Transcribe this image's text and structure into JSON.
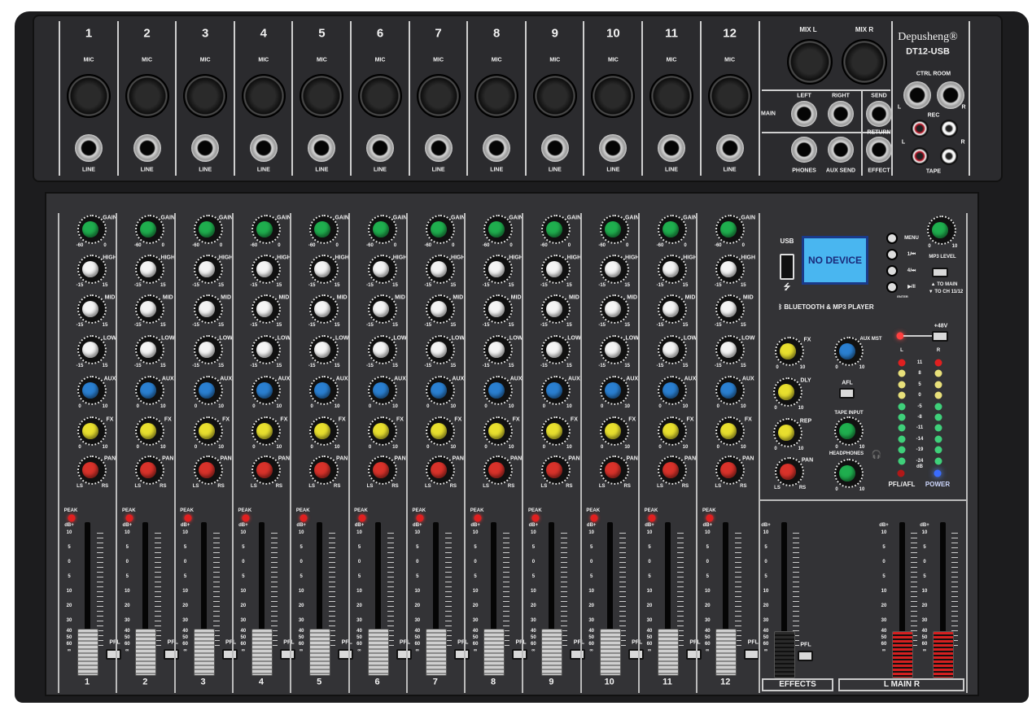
{
  "brand": {
    "name": "Depusheng®",
    "model": "DT12-USB"
  },
  "channels": [
    "1",
    "2",
    "3",
    "4",
    "5",
    "6",
    "7",
    "8",
    "9",
    "10",
    "11",
    "12"
  ],
  "input_labels": {
    "mic": "MIC",
    "line": "LINE"
  },
  "knobs": [
    {
      "label": "GAIN",
      "min": "-60",
      "max": "0",
      "color": "#1fae4e"
    },
    {
      "label": "HIGH",
      "min": "-15",
      "max": "15",
      "color": "#f4f4f4"
    },
    {
      "label": "MID",
      "min": "-15",
      "max": "15",
      "color": "#f4f4f4"
    },
    {
      "label": "LOW",
      "min": "-15",
      "max": "15",
      "color": "#f4f4f4"
    },
    {
      "label": "AUX",
      "min": "0",
      "max": "10",
      "color": "#2a7fd0"
    },
    {
      "label": "FX",
      "min": "0",
      "max": "10",
      "color": "#e8df2e"
    },
    {
      "label": "PAN",
      "min": "LS",
      "max": "RS",
      "color": "#d8322a"
    }
  ],
  "fader_scale": [
    "dB+",
    "10",
    "5",
    "0",
    "5",
    "10",
    "20",
    "30",
    "40",
    "50",
    "60",
    "∞"
  ],
  "peak_label": "PEAK",
  "pfl_label": "PFL",
  "rear_master": {
    "mix_l": "MIX L",
    "mix_r": "MIX R",
    "main": "MAIN",
    "left": "LEFT",
    "right": "RIGHT",
    "send": "SEND",
    "return": "RETURN",
    "phones": "PHONES",
    "aux_send": "AUX SEND",
    "effect": "EFFECT",
    "ctrl_room": "CTRL ROOM",
    "l": "L",
    "r": "R",
    "rec": "REC",
    "tape": "TAPE"
  },
  "mp3": {
    "usb": "USB",
    "display": "NO DEVICE",
    "buttons": [
      "MENU",
      "1/⏮",
      "4/⏭",
      "▶/II"
    ],
    "enter": "ENTER",
    "level": "MP3 LEVEL",
    "level_min": "0",
    "level_max": "10",
    "to_main": "▲ TO MAIN",
    "to_ch": "▼ TO CH 11/12",
    "title": "BLUETOOTH & MP3 PLAYER"
  },
  "master": {
    "fx": "FX",
    "dly": "DLY",
    "rep": "REP",
    "pan": "PAN",
    "aux_mst": "AUX MST",
    "afl": "AFL",
    "tape_input": "TAPE INPUT",
    "headphones": "HEADPHONES",
    "phantom": "+48V",
    "meter_l": "L",
    "meter_r": "R",
    "meter_levels": [
      "11",
      "8",
      "5",
      "0",
      "-5",
      "-8",
      "-11",
      "-14",
      "-19",
      "-24"
    ],
    "db": "dB",
    "pfl_afl": "PFL/AFL",
    "power": "POWER",
    "min": "0",
    "max": "10",
    "ls": "LS",
    "rs": "RS"
  },
  "bottom": {
    "effects": "EFFECTS",
    "main": "L  MAIN  R"
  },
  "colors": {
    "body": "#1c1c1e",
    "panel": "#333336",
    "display": "#49b6f0",
    "led_red": "#e02020",
    "led_yellow": "#e8e07a",
    "led_green": "#3fd07a",
    "led_blue": "#3a6cff",
    "main_fader": "#d52020"
  }
}
